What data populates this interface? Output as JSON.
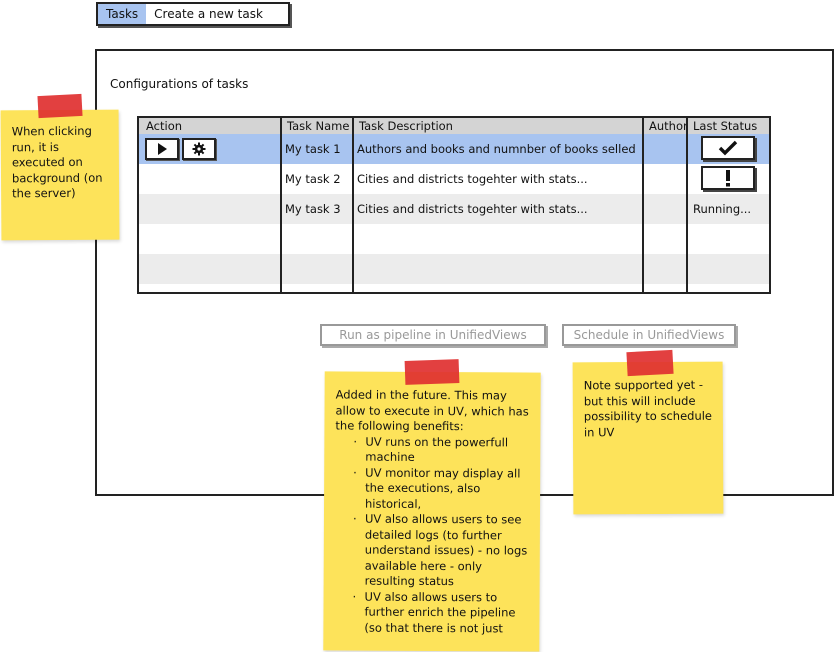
{
  "tabs": [
    {
      "label": "Tasks",
      "active": true
    },
    {
      "label": "Create a new task",
      "active": false
    }
  ],
  "panel": {
    "title": "Configurations of tasks"
  },
  "table": {
    "headers": [
      "Action",
      "Task Name",
      "Task Description",
      "Author",
      "Last Status"
    ],
    "rows": [
      {
        "name": "My task 1",
        "description": "Authors and books and numnber of books selled",
        "author": "",
        "status": "check-icon"
      },
      {
        "name": "My task 2",
        "description": "Cities and districts togehter with stats...",
        "author": "",
        "status": "exclamation-icon"
      },
      {
        "name": "My task 3",
        "description": "Cities and districts togehter with stats...",
        "author": "",
        "status": "Running..."
      },
      {
        "name": "",
        "description": "",
        "author": "",
        "status": ""
      },
      {
        "name": "",
        "description": "",
        "author": "",
        "status": ""
      }
    ]
  },
  "buttons": {
    "run_pipeline": "Run as pipeline in UnifiedViews",
    "schedule": "Schedule in UnifiedViews"
  },
  "notes": {
    "left": "When clicking run, it is executed on background (on the server)",
    "middle": {
      "intro": "Added in the future. This may allow to execute in UV, which has the following benefits:",
      "bullets": [
        "UV runs on the powerfull machine",
        "UV monitor may display all the executions, also historical,",
        "UV also allows users to see detailed logs (to further understand issues) - no logs available here - only resulting status",
        "UV also allows users to further enrich the pipeline (so that there is not just"
      ]
    },
    "right": "Note supported yet - but this will include possibility to schedule in UV"
  },
  "colors": {
    "selected_row": "#a8c4f0",
    "header": "#d4d4d4",
    "alt_row": "#ececec",
    "sticky": "#fde35a",
    "tape": "#e03030"
  }
}
